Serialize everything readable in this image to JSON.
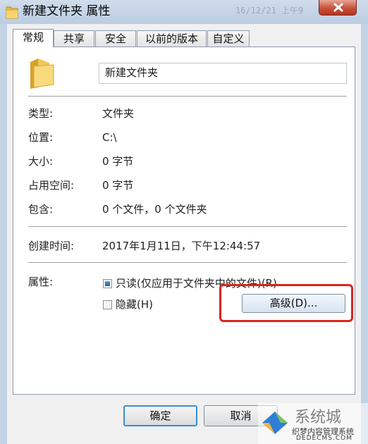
{
  "window": {
    "title": "新建文件夹 属性",
    "background_text": "16/12/21 上午9"
  },
  "tabs": [
    {
      "label": "常规",
      "active": true
    },
    {
      "label": "共享",
      "active": false
    },
    {
      "label": "安全",
      "active": false
    },
    {
      "label": "以前的版本",
      "active": false
    },
    {
      "label": "自定义",
      "active": false
    }
  ],
  "general": {
    "folder_name": "新建文件夹",
    "rows": [
      {
        "label": "类型:",
        "value": "文件夹"
      },
      {
        "label": "位置:",
        "value": "C:\\"
      },
      {
        "label": "大小:",
        "value": "0 字节"
      },
      {
        "label": "占用空间:",
        "value": "0 字节"
      },
      {
        "label": "包含:",
        "value": "0 个文件，0 个文件夹"
      }
    ],
    "created": {
      "label": "创建时间:",
      "value": "2017年1月11日，下午12:44:57"
    },
    "attributes": {
      "label": "属性:",
      "readonly_label": "只读(仅应用于文件夹中的文件)(R)",
      "readonly_checked": true,
      "hidden_label": "隐藏(H)",
      "hidden_checked": false,
      "advanced_button": "高级(D)..."
    }
  },
  "footer": {
    "ok": "确定",
    "cancel": "取消"
  },
  "watermark": {
    "logo_text": "系统城",
    "line1": "织梦内容管理系统",
    "line2": "DEDECMS.COM"
  },
  "colors": {
    "highlight": "#d9251f",
    "checkbox_fill": "#1f5e9e"
  }
}
